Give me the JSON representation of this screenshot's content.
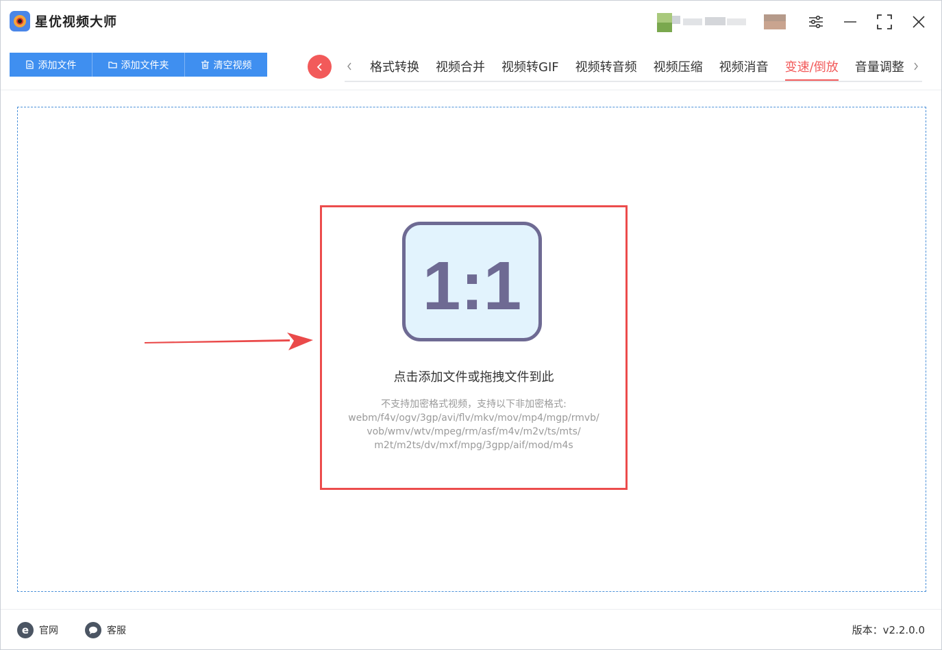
{
  "app": {
    "title": "星优视频大师"
  },
  "toolbar": {
    "buttons": [
      {
        "label": "添加文件"
      },
      {
        "label": "添加文件夹"
      },
      {
        "label": "清空视频"
      }
    ]
  },
  "tabs": {
    "items": [
      {
        "label": "格式转换"
      },
      {
        "label": "视频合并"
      },
      {
        "label": "视频转GIF"
      },
      {
        "label": "视频转音频"
      },
      {
        "label": "视频压缩"
      },
      {
        "label": "视频消音"
      },
      {
        "label": "变速/倒放",
        "active": true
      },
      {
        "label": "音量调整"
      }
    ],
    "accent_color": "#f25a5a"
  },
  "dropzone": {
    "icon": "aspect-ratio-1-1-icon",
    "icon_text": "1:1",
    "main_text": "点击添加文件或拖拽文件到此",
    "sub_lines": [
      "不支持加密格式视频，支持以下非加密格式:",
      "webm/f4v/ogv/3gp/avi/flv/mkv/mov/mp4/mgp/rmvb/",
      "vob/wmv/wtv/mpeg/rm/asf/m4v/m2v/ts/mts/",
      "m2t/m2ts/dv/mxf/mpg/3gpp/aif/mod/m4s"
    ]
  },
  "footer": {
    "website_label": "官网",
    "support_label": "客服",
    "version": "版本：v2.2.0.0"
  },
  "colors": {
    "primary": "#3f8ff0",
    "highlight_box": "#ec4c4c",
    "dropzone_border": "#4a90d9"
  }
}
